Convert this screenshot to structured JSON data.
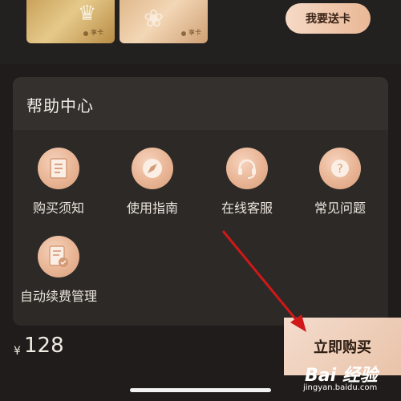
{
  "cards": [
    {
      "label": "享卡"
    },
    {
      "label": "享卡"
    }
  ],
  "gift_button": {
    "label": "我要送卡"
  },
  "help_center": {
    "title": "帮助中心",
    "items": [
      {
        "label": "购买须知",
        "icon": "document-icon"
      },
      {
        "label": "使用指南",
        "icon": "compass-icon"
      },
      {
        "label": "在线客服",
        "icon": "headset-icon"
      },
      {
        "label": "常见问题",
        "icon": "question-icon"
      },
      {
        "label": "自动续费管理",
        "icon": "renewal-document-icon"
      }
    ]
  },
  "purchase": {
    "currency": "¥",
    "price": "128",
    "buy_label": "立即购买"
  },
  "watermark": {
    "logo": "Bai 经验",
    "url": "jingyan.baidu.com"
  },
  "colors": {
    "accent": "#e9b896",
    "background": "#1f1c1b",
    "panel": "#2c2927",
    "annotation_arrow": "#d01818"
  }
}
